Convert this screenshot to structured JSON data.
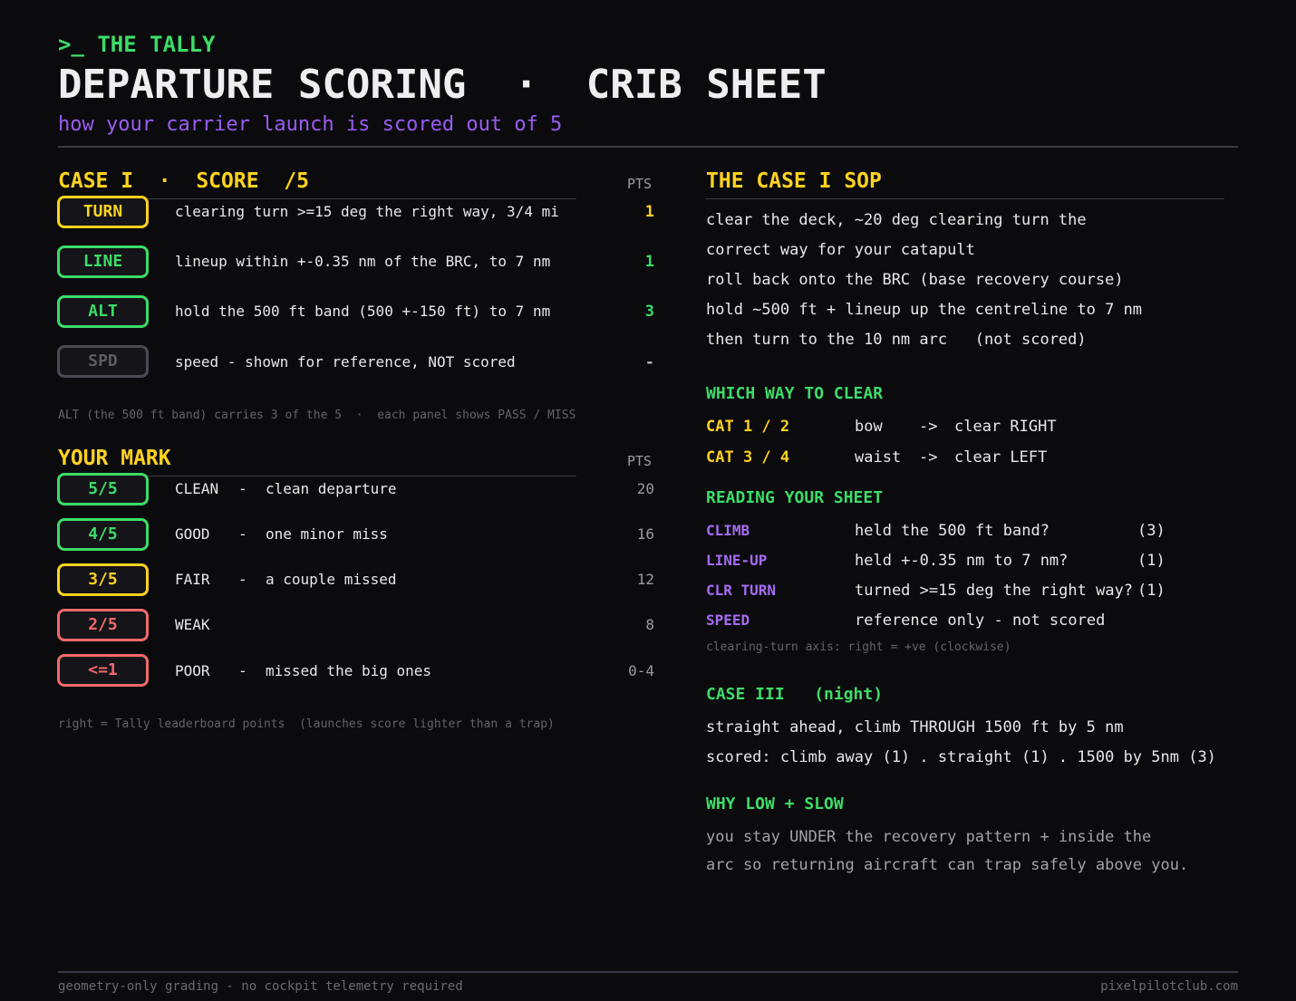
{
  "header": {
    "brand": ">_ THE TALLY",
    "title": "DEPARTURE SCORING  ·  CRIB SHEET",
    "subtitle": "how your carrier launch is scored out of 5"
  },
  "score_section": {
    "title": "CASE I  ·  SCORE  /5",
    "pts_header": "PTS",
    "rows": [
      {
        "badge": "TURN",
        "text": "clearing turn >=15 deg the right way, 3/4 mi",
        "pts": "1",
        "color": "#ffd21f"
      },
      {
        "badge": "LINE",
        "text": "lineup within +-0.35 nm of the BRC, to 7 nm",
        "pts": "1",
        "color": "#3ddc68"
      },
      {
        "badge": "ALT",
        "text": "hold the 500 ft band (500 +-150 ft) to 7 nm",
        "pts": "3",
        "color": "#3ddc68"
      },
      {
        "badge": "SPD",
        "text": "speed - shown for reference, NOT scored",
        "pts": "-",
        "color": "#b0b0b8"
      }
    ],
    "note": "ALT (the 500 ft band) carries 3 of the 5  ·  each panel shows PASS / MISS"
  },
  "mark_section": {
    "title": "YOUR MARK",
    "pts_header": "PTS",
    "rows": [
      {
        "badge": "5/5",
        "grade": "CLEAN",
        "sep": "-",
        "desc": "clean departure",
        "pts": "20"
      },
      {
        "badge": "4/5",
        "grade": "GOOD",
        "sep": "-",
        "desc": "one minor miss",
        "pts": "16"
      },
      {
        "badge": "3/5",
        "grade": "FAIR",
        "sep": "-",
        "desc": "a couple missed",
        "pts": "12"
      },
      {
        "badge": "2/5",
        "grade": "WEAK",
        "sep": "",
        "desc": "",
        "pts": "8"
      },
      {
        "badge": "<=1",
        "grade": "POOR",
        "sep": "-",
        "desc": "missed the big ones",
        "pts": "0-4"
      }
    ],
    "note": "right = Tally leaderboard points  (launches score lighter than a trap)"
  },
  "sop": {
    "title": "THE CASE I SOP",
    "lines": [
      "clear the deck, ~20 deg clearing turn the",
      "correct way for your catapult",
      "roll back onto the BRC (base recovery course)",
      "hold ~500 ft + lineup up the centreline to 7 nm",
      "then turn to the 10 nm arc   (not scored)"
    ]
  },
  "which_way": {
    "title": "WHICH WAY TO CLEAR",
    "rows": [
      {
        "cat": "CAT 1 / 2",
        "pos": "bow",
        "arrow": "->",
        "action": "clear RIGHT"
      },
      {
        "cat": "CAT 3 / 4",
        "pos": "waist",
        "arrow": "->",
        "action": "clear LEFT"
      }
    ]
  },
  "reading": {
    "title": "READING YOUR SHEET",
    "rows": [
      {
        "label": "CLIMB",
        "text": "held the 500 ft band?",
        "pts": "(3)"
      },
      {
        "label": "LINE-UP",
        "text": "held +-0.35 nm to 7 nm?",
        "pts": "(1)"
      },
      {
        "label": "CLR TURN",
        "text": "turned >=15 deg the right way?",
        "pts": "(1)"
      },
      {
        "label": "SPEED",
        "text": "reference only - not scored",
        "pts": ""
      }
    ],
    "note": "clearing-turn axis: right = +ve (clockwise)"
  },
  "case3": {
    "title": "CASE III   (night)",
    "lines": [
      "straight ahead, climb THROUGH 1500 ft by 5 nm",
      "scored: climb away (1) . straight (1) . 1500 by 5nm (3)"
    ]
  },
  "why": {
    "title": "WHY LOW + SLOW",
    "lines": [
      "you stay UNDER the recovery pattern + inside the",
      "arc so returning aircraft can trap safely above you."
    ]
  },
  "footer": {
    "left": "geometry-only grading - no cockpit telemetry required",
    "right": "pixelpilotclub.com"
  }
}
